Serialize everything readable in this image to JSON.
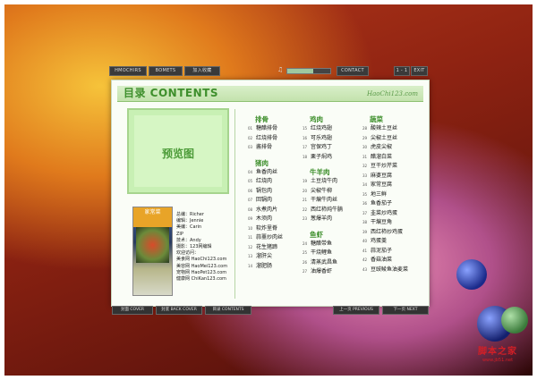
{
  "topbar": {
    "buttons": [
      "HMOCHIRS",
      "BOMETS",
      "加入收藏"
    ],
    "volume_level": 0.6,
    "contact": "CONTACT",
    "page": "1 - 1",
    "exit": "EXIT"
  },
  "book": {
    "title": "目录 CONTENTS",
    "site": "HaoChi123.com",
    "preview_label": "预览图",
    "cover_text": "家常菜",
    "credits": [
      "总编：Richer",
      "编辑：Jennie",
      "美编：Carin",
      "      ZIP",
      "技术：Andy",
      "摄影：123网编辑",
      "欢迎访问：",
      "美食网 HaoChi123.com",
      "美容网 HaoMei123.com",
      "宠物网 HaoPet123.com",
      "健康网 ChiKan123.com"
    ],
    "columns": [
      {
        "sections": [
          {
            "title": "排骨",
            "items": [
              {
                "num": "01",
                "name": "糖醋排骨"
              },
              {
                "num": "02",
                "name": "红烧排骨"
              },
              {
                "num": "03",
                "name": "酱排骨"
              }
            ]
          },
          {
            "title": "猪肉",
            "items": [
              {
                "num": "04",
                "name": "鱼香肉丝"
              },
              {
                "num": "05",
                "name": "红烧肉"
              },
              {
                "num": "06",
                "name": "锅包肉"
              },
              {
                "num": "07",
                "name": "回锅肉"
              },
              {
                "num": "08",
                "name": "水煮肉片"
              },
              {
                "num": "09",
                "name": "木须肉"
              },
              {
                "num": "10",
                "name": "软炸里脊"
              },
              {
                "num": "11",
                "name": "蒜薹炒肉丝"
              },
              {
                "num": "12",
                "name": "花生猪蹄"
              },
              {
                "num": "13",
                "name": "溜肝尖"
              },
              {
                "num": "14",
                "name": "溜肥肠"
              }
            ]
          }
        ]
      },
      {
        "sections": [
          {
            "title": "鸡肉",
            "items": [
              {
                "num": "15",
                "name": "红烧鸡翅"
              },
              {
                "num": "16",
                "name": "可乐鸡翅"
              },
              {
                "num": "17",
                "name": "宫保鸡丁"
              },
              {
                "num": "18",
                "name": "栗子焖鸡"
              }
            ]
          },
          {
            "title": "牛羊肉",
            "items": [
              {
                "num": "19",
                "name": "土豆烧牛肉"
              },
              {
                "num": "20",
                "name": "尖椒牛柳"
              },
              {
                "num": "21",
                "name": "干煸牛肉丝"
              },
              {
                "num": "22",
                "name": "西红柿炖牛腩"
              },
              {
                "num": "23",
                "name": "葱爆羊肉"
              }
            ]
          },
          {
            "title": "鱼虾",
            "items": [
              {
                "num": "24",
                "name": "糖醋带鱼"
              },
              {
                "num": "25",
                "name": "干烧鲤鱼"
              },
              {
                "num": "26",
                "name": "清蒸武昌鱼"
              },
              {
                "num": "27",
                "name": "油爆香虾"
              }
            ]
          }
        ]
      },
      {
        "sections": [
          {
            "title": "蔬菜",
            "items": [
              {
                "num": "28",
                "name": "酸辣土豆丝"
              },
              {
                "num": "29",
                "name": "尖椒土豆丝"
              },
              {
                "num": "30",
                "name": "虎皮尖椒"
              },
              {
                "num": "31",
                "name": "醋溜白菜"
              },
              {
                "num": "32",
                "name": "豆干炒芹菜"
              },
              {
                "num": "33",
                "name": "麻婆豆腐"
              },
              {
                "num": "34",
                "name": "家常豆腐"
              },
              {
                "num": "35",
                "name": "地三鲜"
              },
              {
                "num": "36",
                "name": "鱼香茄子"
              },
              {
                "num": "37",
                "name": "韭菜炒鸡蛋"
              },
              {
                "num": "38",
                "name": "干煸豆角"
              },
              {
                "num": "39",
                "name": "西红柿炒鸡蛋"
              },
              {
                "num": "40",
                "name": "鸡蛋羹"
              },
              {
                "num": "41",
                "name": "蒜泥茄子"
              },
              {
                "num": "42",
                "name": "香菇油菜"
              },
              {
                "num": "43",
                "name": "豆豉鲮鱼油麦菜"
              }
            ]
          }
        ]
      }
    ]
  },
  "bottombar": {
    "front_cover": "封面 COVER",
    "back_cover": "封底 BACK COVER",
    "contents": "目录 CONTENTS",
    "prev": "上一页 PREVIOUS",
    "next": "下一页 NEXT"
  },
  "watermark": {
    "line1": "脚本之家",
    "line2": "www.jb51.net"
  }
}
